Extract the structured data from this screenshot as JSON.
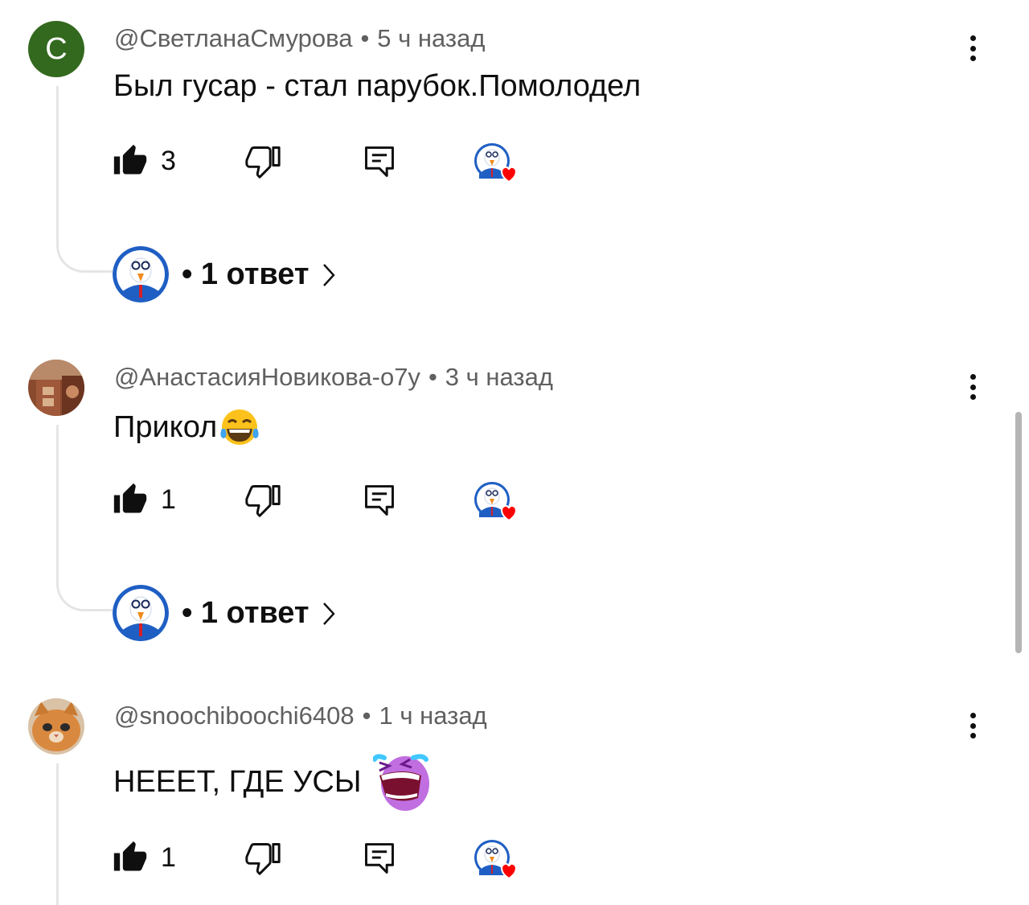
{
  "colors": {
    "meta_text": "#606060",
    "body_text": "#0f0f0f",
    "thread_line": "#e5e5e5",
    "heart": "#ff0000",
    "letter_avatar_bg": "#33691e"
  },
  "comments": [
    {
      "avatar_letter": "С",
      "author": "@СветланаСмурова",
      "separator": "•",
      "time": "5 ч назад",
      "text": "Был гусар - стал парубок.Помолодел",
      "likes": "3",
      "replies_label": "• 1 ответ",
      "hearted_by_creator": true
    },
    {
      "avatar_icon": "photo-avatar",
      "author": "@АнастасияНовикова-о7у",
      "separator": "•",
      "time": "3 ч назад",
      "text": "Прикол",
      "text_emoji": "laughing-tears-emoji",
      "likes": "1",
      "replies_label": "• 1 ответ",
      "hearted_by_creator": true
    },
    {
      "avatar_icon": "cat-avatar",
      "author": "@snoochiboochi6408",
      "separator": "•",
      "time": "1 ч назад",
      "text": "НЕЕЕТ, ГДЕ УСЫ",
      "text_emoji": "crying-purple-emoji",
      "likes": "1",
      "hearted_by_creator": true
    }
  ],
  "icons": {
    "like": "thumbs-up-icon",
    "dislike": "thumbs-down-icon",
    "reply": "reply-comment-icon",
    "menu": "more-vertical-icon",
    "chevron": "chevron-right-icon",
    "creator_heart": "creator-heart-icon"
  }
}
